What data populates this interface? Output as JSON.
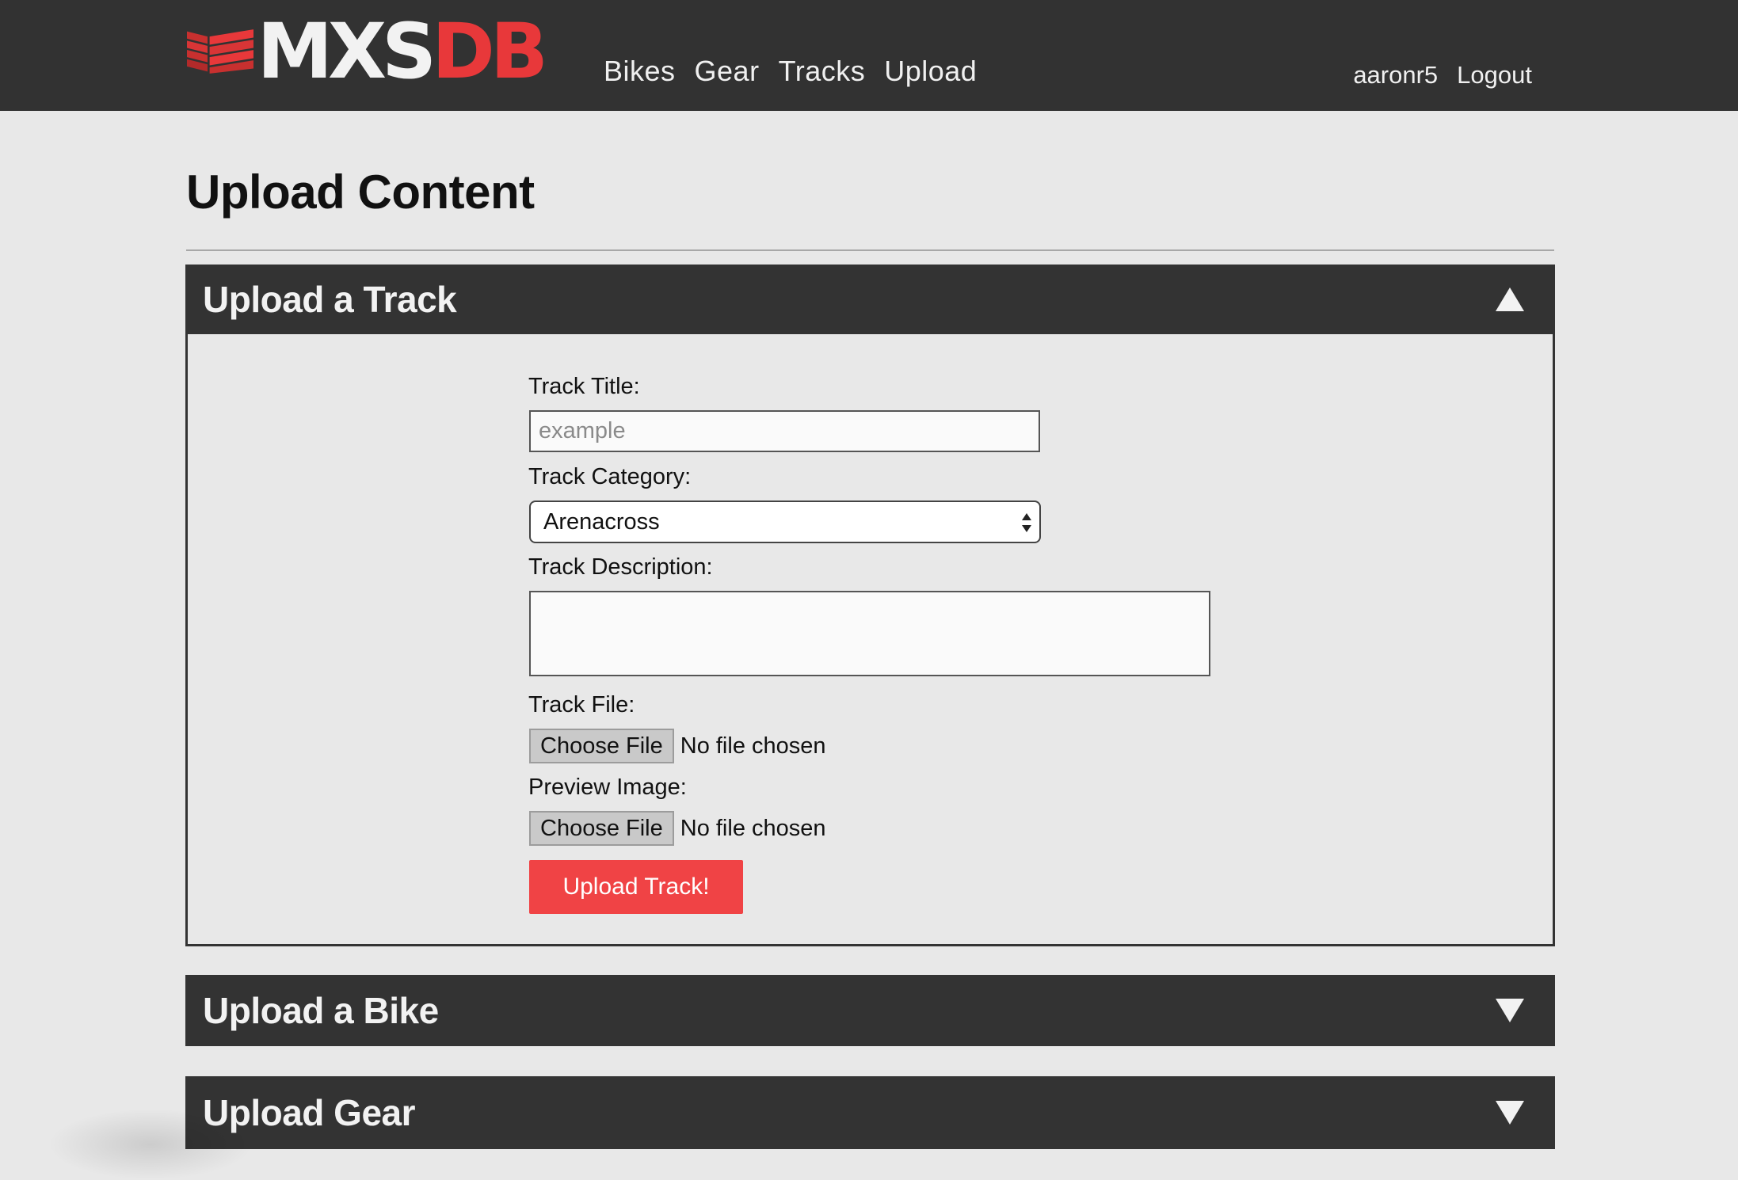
{
  "brand": {
    "logo_text_primary": "MXS",
    "logo_text_accent": "DB",
    "accent_color": "#e8383a",
    "topbar_color": "#323232"
  },
  "nav": {
    "items": [
      {
        "label": "Bikes"
      },
      {
        "label": "Gear"
      },
      {
        "label": "Tracks"
      },
      {
        "label": "Upload"
      }
    ]
  },
  "user": {
    "username": "aaronr5",
    "logout_label": "Logout"
  },
  "page": {
    "title": "Upload Content"
  },
  "panels": [
    {
      "title": "Upload a Track",
      "expanded": true,
      "chevron_icon": "chevron-up-icon"
    },
    {
      "title": "Upload a Bike",
      "expanded": false,
      "chevron_icon": "chevron-down-icon"
    },
    {
      "title": "Upload Gear",
      "expanded": false,
      "chevron_icon": "chevron-down-icon"
    }
  ],
  "track_form": {
    "title_label": "Track Title:",
    "title_placeholder": "example",
    "title_value": "",
    "category_label": "Track Category:",
    "category_selected": "Arenacross",
    "description_label": "Track Description:",
    "description_value": "",
    "file_label": "Track File:",
    "file_button": "Choose File",
    "file_status": "No file chosen",
    "preview_label": "Preview Image:",
    "preview_button": "Choose File",
    "preview_status": "No file chosen",
    "submit_label": "Upload Track!",
    "submit_color": "#f04345"
  }
}
